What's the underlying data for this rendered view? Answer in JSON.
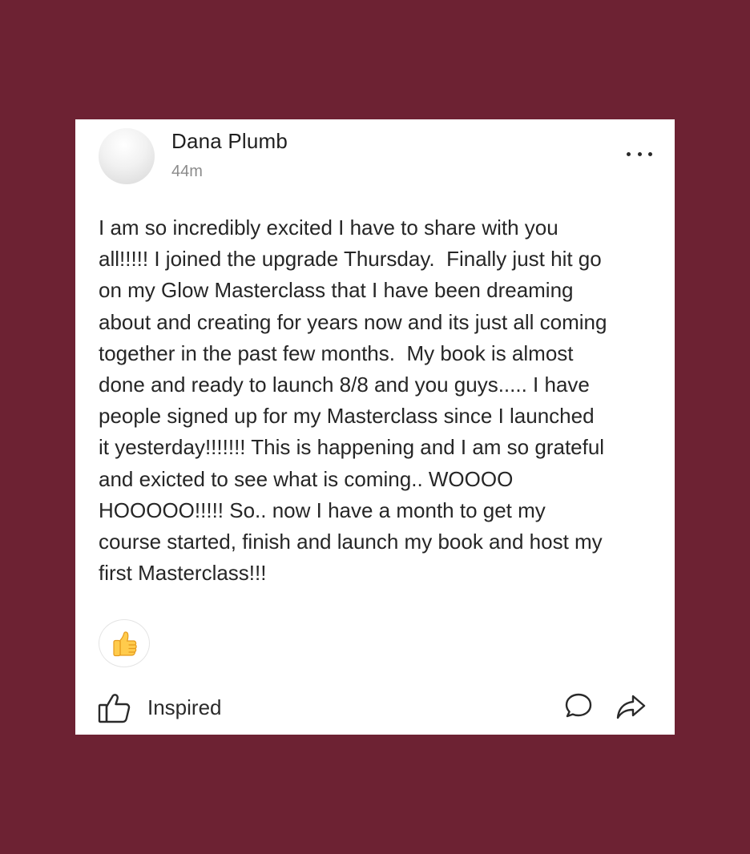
{
  "post": {
    "author": "Dana Plumb",
    "time": "44m",
    "body": "I am so incredibly excited I have to share with you\nall!!!!! I joined the upgrade Thursday.  Finally just hit go\non my Glow Masterclass that I have been dreaming\nabout and creating for years now and its just all coming\ntogether in the past few months.  My book is almost\ndone and ready to launch 8/8 and you guys..... I have\npeople signed up for my Masterclass since I launched\nit yesterday!!!!!!! This is happening and I am so grateful\nand exicted to see what is coming.. WOOOO\nHOOOOO!!!!! So.. now I have a month to get my\ncourse started, finish and launch my book and host my\nfirst Masterclass!!!"
  },
  "reactions": {
    "icon": "thumbs-up-emoji"
  },
  "actions": {
    "like_label": "Inspired",
    "like_icon": "thumbs-up-outline-icon",
    "comment_icon": "comment-bubble-icon",
    "share_icon": "share-arrow-icon",
    "more_icon": "more-dots-icon"
  },
  "colors": {
    "background": "#6d2233",
    "card": "#ffffff",
    "text": "#262626",
    "muted": "#8b8b8b"
  }
}
